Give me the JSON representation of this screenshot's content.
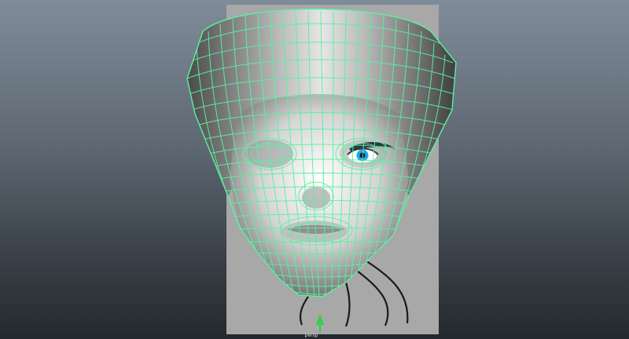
{
  "viewport": {
    "manipulator_label": "persp"
  },
  "colors": {
    "background_top": "#7f8c99",
    "background_bottom": "#24292e",
    "wireframe": "#5cf0a0",
    "reference_plane": "#a8a8a8",
    "iris": "#1ea8e8"
  },
  "icons": {
    "manipulator": "arrow-up-icon"
  }
}
